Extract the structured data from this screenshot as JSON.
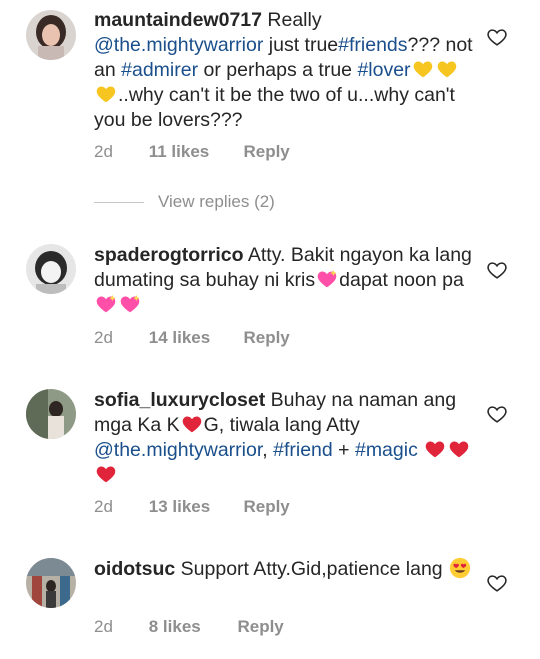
{
  "comments": [
    {
      "username": "mauntaindew0717",
      "time": "2d",
      "likes": "11 likes",
      "reply": "Reply",
      "text": {
        "t1": "Really",
        "mention": "@the.mightywarrior",
        "t2": "just true",
        "tag_friends": "#friends",
        "t3": "??? not an",
        "tag_admirer": "#admirer",
        "t4": "or perhaps a true",
        "tag_lover": "#lover",
        "t5": "..why can't it be the two of u...why can't you be lovers???"
      },
      "emojis": [
        "yellow-heart",
        "yellow-heart",
        "yellow-heart"
      ]
    },
    {
      "username": "spaderogtorrico",
      "time": "2d",
      "likes": "14 likes",
      "reply": "Reply",
      "text": {
        "t1": "Atty. Bakit ngayon ka lang dumating sa buhay ni kris",
        "t2": "dapat noon pa"
      },
      "emojis": [
        "sparkling-heart",
        "sparkling-heart",
        "sparkling-heart"
      ]
    },
    {
      "username": "sofia_luxurycloset",
      "time": "2d",
      "likes": "13 likes",
      "reply": "Reply",
      "text": {
        "t1": "Buhay na naman ang mga Ka K",
        "t2": "G, tiwala lang Atty",
        "mention": "@the.mightywarrior",
        "sep": ",",
        "tag_friend": "#friend",
        "plus": "+",
        "tag_magic": "#magic"
      },
      "emojis": [
        "red-heart",
        "red-heart",
        "red-heart",
        "red-heart"
      ]
    },
    {
      "username": "oidotsuc",
      "time": "2d",
      "likes": "8 likes",
      "reply": "Reply",
      "text": {
        "t1": "Support Atty.Gid,patience lang"
      },
      "emojis": [
        "heart-eyes-face"
      ]
    }
  ],
  "view_replies": "View replies (2)",
  "colors": {
    "link": "#1a4f8c",
    "meta": "#8e8e8e",
    "text": "#262626"
  }
}
